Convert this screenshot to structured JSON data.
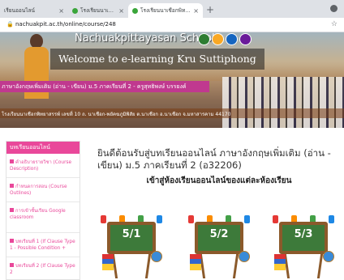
{
  "browser": {
    "tabs": [
      {
        "label": "เรียนออนไลน์",
        "active": false
      },
      {
        "label": "โรงเรียนนาเชือกพิทยาสรรพ์",
        "active": false
      },
      {
        "label": "โรงเรียนนาเชือกพิทยาสรรพ์ - บทเรียน",
        "active": true
      }
    ],
    "close_glyph": "×",
    "new_tab_glyph": "+",
    "url": "nachuakpit.ac.th/online/course/248"
  },
  "banner": {
    "school_name": "Nachuakpittayasan School",
    "welcome": "Welcome to e-learning Kru Suttiphong",
    "course_title": "ภาษาอังกฤษเพิ่มเติม (อ่าน - เขียน) ม.5 ภาคเรียนที่ 2 - ครูสุทธิพงษ์ บรรยงค์",
    "address": "โรงเรียนนาเชือกพิทยาสรรพ์ เลขที่ 10 ถ. นาเชือก-พยัคฆภูมิพิสัย ต.นาเชือก อ.นาเชือก จ.มหาสารคาม 44170",
    "logo_colors": [
      "#2e7d32",
      "#f9a825",
      "#1565c0",
      "#6a1b9a"
    ]
  },
  "sidebar": {
    "heading": "บทเรียนออนไลน์",
    "items": [
      {
        "label": "คำอธิบายรายวิชา (Course Description)"
      },
      {
        "label": "กำหนดการสอน (Course Outlines)"
      },
      {
        "label": "การเข้าชั้นเรียน Google classroom"
      },
      {
        "label": "บทเรียนที่ 1 (If Clause Type 1 - Possible Condition +"
      },
      {
        "label": "บทเรียนที่ 2 (If Clause Type 2"
      }
    ]
  },
  "main": {
    "welcome_line": "ยินดีต้อนรับสู่บทเรียนออนไลน์ ภาษาอังกฤษเพิ่มเติม (อ่าน - เขียน) ม.5 ภาคเรียนที่ 2 (อ32206)",
    "subheading": "เข้าสู่ห้องเรียนออนไลน์ของแต่ละห้องเรียน",
    "classrooms": [
      {
        "label": "5/1"
      },
      {
        "label": "5/2"
      },
      {
        "label": "5/3"
      }
    ]
  },
  "colors": {
    "accent": "#e9489a",
    "course_bar": "#c0398f",
    "board_green": "#3d7a3a",
    "board_frame": "#8b5a2b"
  }
}
